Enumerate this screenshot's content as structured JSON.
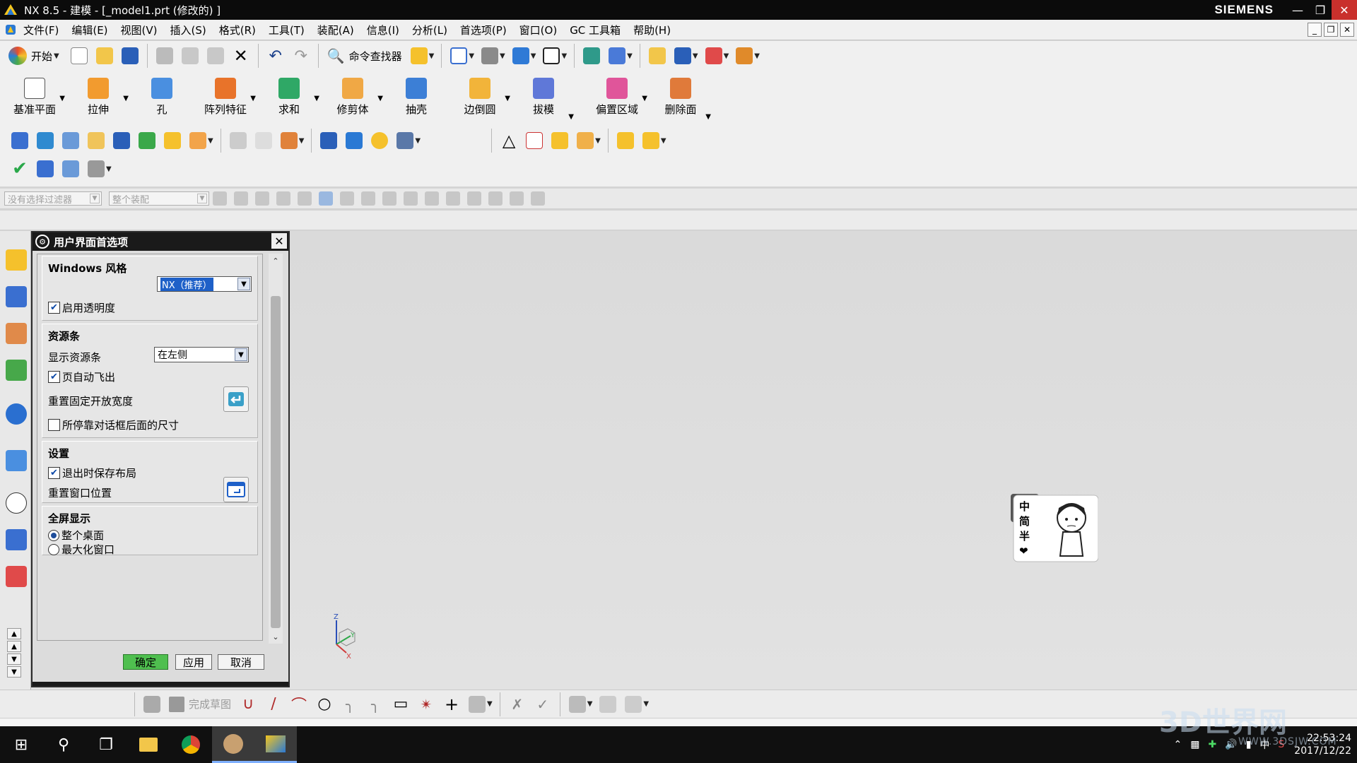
{
  "window": {
    "title": "NX 8.5 - 建模 - [_model1.prt  (修改的) ]",
    "brand": "SIEMENS",
    "controls": [
      "minimize-icon",
      "restore-icon",
      "close-icon"
    ]
  },
  "menu": {
    "items": [
      "文件(F)",
      "编辑(E)",
      "视图(V)",
      "插入(S)",
      "格式(R)",
      "工具(T)",
      "装配(A)",
      "信息(I)",
      "分析(L)",
      "首选项(P)",
      "窗口(O)",
      "GC 工具箱",
      "帮助(H)"
    ]
  },
  "standard_toolbar": {
    "start_label": "开始",
    "command_finder_label": "命令查找器"
  },
  "feature_toolbar": {
    "items": [
      {
        "label": "基准平面",
        "color": "#ffffff"
      },
      {
        "label": "拉伸",
        "color": "#f29b2f"
      },
      {
        "label": "孔",
        "color": "#4a8fe0"
      },
      {
        "label": "阵列特征",
        "color": "#e8732a"
      },
      {
        "label": "求和",
        "color": "#2fa866"
      },
      {
        "label": "修剪体",
        "color": "#f0a845"
      },
      {
        "label": "抽壳",
        "color": "#3c7fd6"
      },
      {
        "label": "边倒圆",
        "color": "#f2b43a"
      },
      {
        "label": "拔模",
        "color": "#5f78d8"
      },
      {
        "label": "偏置区域",
        "color": "#e0559a"
      },
      {
        "label": "删除面",
        "color": "#e07a3a"
      }
    ]
  },
  "selection_bar": {
    "filter_placeholder": "没有选择过滤器",
    "assembly_placeholder": "整个装配"
  },
  "dialog": {
    "title": "用户界面首选项",
    "groups": {
      "windows_style": {
        "title": "Windows 风格",
        "style_value": "NX（推荐）",
        "transparency_label": "启用透明度",
        "transparency_checked": true
      },
      "resource_bar": {
        "title": "资源条",
        "display_label": "显示资源条",
        "display_value": "在左侧",
        "auto_flyout_label": "页自动飞出",
        "auto_flyout_checked": true,
        "reset_width_label": "重置固定开放宽度",
        "docked_size_label": "所停靠对话框后面的尺寸",
        "docked_size_checked": false
      },
      "settings": {
        "title": "设置",
        "save_layout_label": "退出时保存布局",
        "save_layout_checked": true,
        "reset_window_label": "重置窗口位置"
      },
      "fullscreen": {
        "title": "全屏显示",
        "option_whole": "整个桌面",
        "option_max": "最大化窗口",
        "selected": "整个桌面"
      }
    },
    "buttons": {
      "ok": "确定",
      "apply": "应用",
      "cancel": "取消"
    }
  },
  "sketch_toolbar": {
    "finish_label": "完成草图"
  },
  "sticker": {
    "text": [
      "中",
      "简",
      "半",
      "❤"
    ]
  },
  "taskbar": {
    "time": "22:53:24",
    "date": "2017/12/22",
    "ime": "中"
  },
  "watermark": {
    "text": "3D世界网",
    "url": "WWW.3DSJW.COM"
  }
}
